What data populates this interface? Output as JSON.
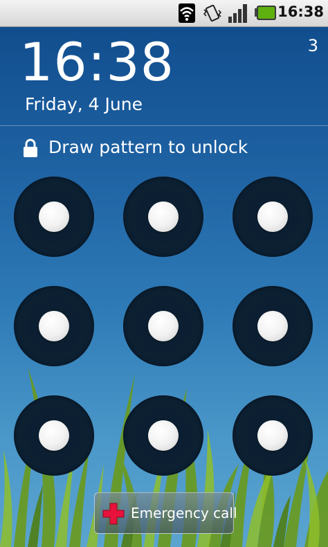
{
  "status_bar": {
    "time": "16:38",
    "icons": [
      "wifi-icon",
      "vibrate-icon",
      "signal-icon",
      "battery-icon"
    ],
    "battery_color": "#5fb10f"
  },
  "lock_screen": {
    "clock": "16:38",
    "date": "Friday, 4 June",
    "alarm_count": "3",
    "instruction": "Draw pattern to unlock",
    "pattern_dots": 9,
    "emergency_label": "Emergency call"
  },
  "colors": {
    "background_top": "#0f4a8a",
    "background_bottom": "#5aa4cf",
    "emergency_cross": "#e8123c"
  }
}
